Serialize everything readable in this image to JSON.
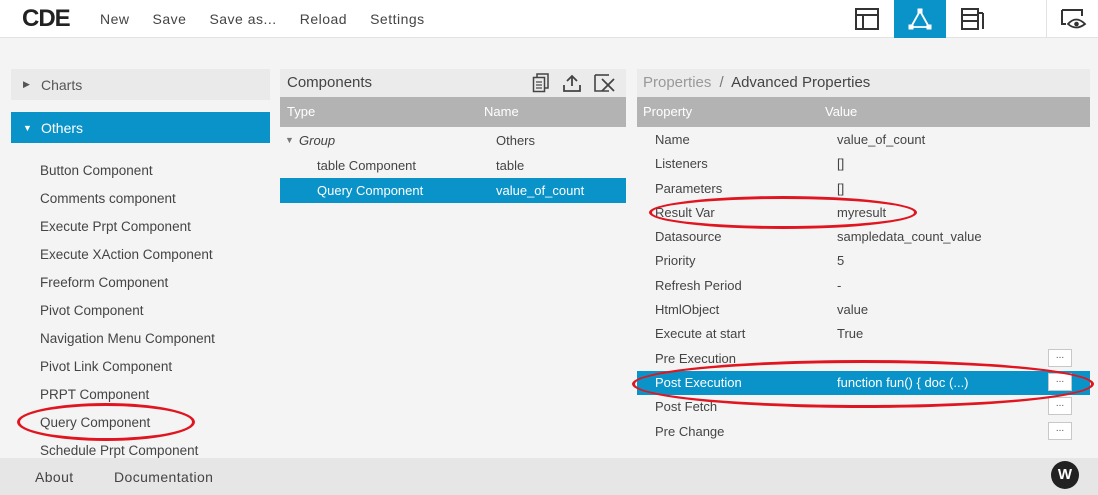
{
  "app": {
    "logo": "CDE",
    "menu": [
      "New",
      "Save",
      "Save as...",
      "Reload",
      "Settings"
    ]
  },
  "sidebar": {
    "categories": [
      {
        "label": "Charts",
        "expanded": false
      },
      {
        "label": "Others",
        "expanded": true
      }
    ],
    "items": [
      "Button Component",
      "Comments component",
      "Execute Prpt Component",
      "Execute XAction Component",
      "Freeform Component",
      "Pivot Component",
      "Navigation Menu Component",
      "Pivot Link Component",
      "PRPT Component",
      "Query Component",
      "Schedule Prpt Component"
    ]
  },
  "components": {
    "title": "Components",
    "columns": {
      "type": "Type",
      "name": "Name"
    },
    "rows": [
      {
        "type": "Group",
        "name": "Others"
      },
      {
        "type": "table Component",
        "name": "table"
      },
      {
        "type": "Query Component",
        "name": "value_of_count"
      }
    ]
  },
  "properties": {
    "crumb_root": "Properties",
    "crumb_sep": "/",
    "crumb_current": "Advanced Properties",
    "columns": {
      "property": "Property",
      "value": "Value"
    },
    "rows": [
      {
        "property": "Name",
        "value": "value_of_count"
      },
      {
        "property": "Listeners",
        "value": "[]"
      },
      {
        "property": "Parameters",
        "value": "[]"
      },
      {
        "property": "Result Var",
        "value": "myresult"
      },
      {
        "property": "Datasource",
        "value": "sampledata_count_value"
      },
      {
        "property": "Priority",
        "value": "5"
      },
      {
        "property": "Refresh Period",
        "value": "-"
      },
      {
        "property": "HtmlObject",
        "value": "value"
      },
      {
        "property": "Execute at start",
        "value": "True"
      },
      {
        "property": "Pre Execution",
        "value": ""
      },
      {
        "property": "Post Execution",
        "value": "function fun() { doc (...)"
      },
      {
        "property": "Post Fetch",
        "value": ""
      },
      {
        "property": "Pre Change",
        "value": ""
      }
    ],
    "edit_button_label": "..."
  },
  "footer": {
    "about": "About",
    "documentation": "Documentation",
    "badge": "W"
  },
  "colors": {
    "accent": "#0a93c8",
    "annotation": "#e0151f"
  }
}
